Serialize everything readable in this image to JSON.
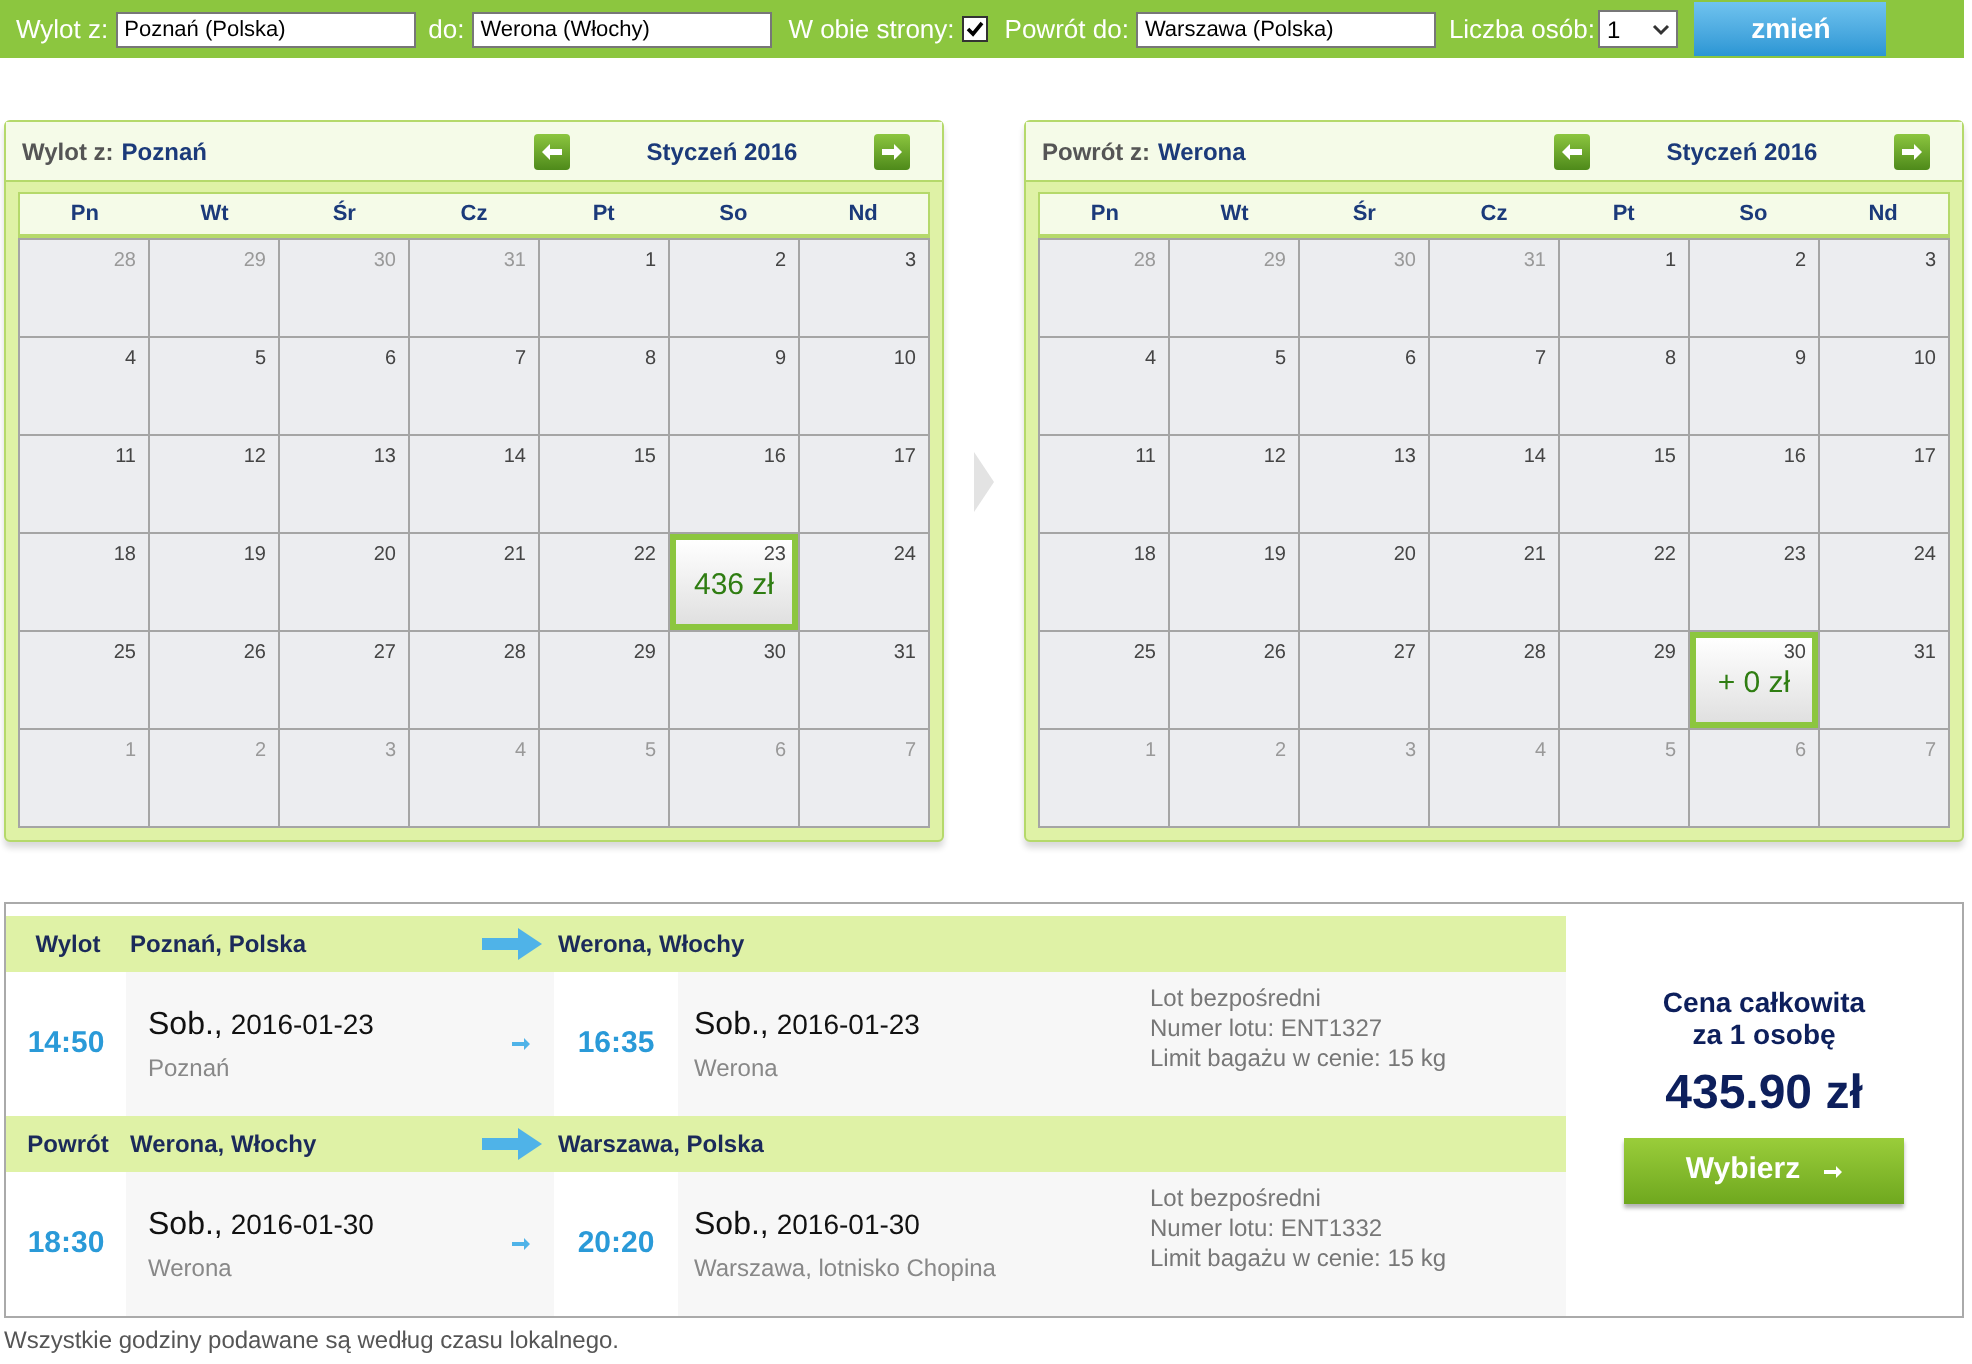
{
  "search_bar": {
    "from_label": "Wylot z:",
    "from_value": "Poznań (Polska)",
    "to_label": "do:",
    "to_value": "Werona (Włochy)",
    "round_trip_label": "W obie strony:",
    "round_trip_checked": true,
    "return_label": "Powrót do:",
    "return_value": "Warszawa (Polska)",
    "persons_label": "Liczba osób:",
    "persons_value": "1",
    "submit": "zmień"
  },
  "calendars": [
    {
      "label": "Wylot z:",
      "city": "Poznań",
      "month": "Styczeń 2016",
      "weekdays": [
        "Pn",
        "Wt",
        "Śr",
        "Cz",
        "Pt",
        "So",
        "Nd"
      ],
      "weeks": [
        [
          {
            "day": "28",
            "muted": true,
            "selected": false
          },
          {
            "day": "29",
            "muted": true,
            "selected": false
          },
          {
            "day": "30",
            "muted": true,
            "selected": false
          },
          {
            "day": "31",
            "muted": true,
            "selected": false
          },
          {
            "day": "1",
            "muted": false,
            "selected": false
          },
          {
            "day": "2",
            "muted": false,
            "selected": false
          },
          {
            "day": "3",
            "muted": false,
            "selected": false
          }
        ],
        [
          {
            "day": "4",
            "muted": false,
            "selected": false
          },
          {
            "day": "5",
            "muted": false,
            "selected": false
          },
          {
            "day": "6",
            "muted": false,
            "selected": false
          },
          {
            "day": "7",
            "muted": false,
            "selected": false
          },
          {
            "day": "8",
            "muted": false,
            "selected": false
          },
          {
            "day": "9",
            "muted": false,
            "selected": false
          },
          {
            "day": "10",
            "muted": false,
            "selected": false
          }
        ],
        [
          {
            "day": "11",
            "muted": false,
            "selected": false
          },
          {
            "day": "12",
            "muted": false,
            "selected": false
          },
          {
            "day": "13",
            "muted": false,
            "selected": false
          },
          {
            "day": "14",
            "muted": false,
            "selected": false
          },
          {
            "day": "15",
            "muted": false,
            "selected": false
          },
          {
            "day": "16",
            "muted": false,
            "selected": false
          },
          {
            "day": "17",
            "muted": false,
            "selected": false
          }
        ],
        [
          {
            "day": "18",
            "muted": false,
            "selected": false
          },
          {
            "day": "19",
            "muted": false,
            "selected": false
          },
          {
            "day": "20",
            "muted": false,
            "selected": false
          },
          {
            "day": "21",
            "muted": false,
            "selected": false
          },
          {
            "day": "22",
            "muted": false,
            "selected": false
          },
          {
            "day": "23",
            "muted": false,
            "selected": true,
            "price": "436 zł"
          },
          {
            "day": "24",
            "muted": false,
            "selected": false
          }
        ],
        [
          {
            "day": "25",
            "muted": false,
            "selected": false
          },
          {
            "day": "26",
            "muted": false,
            "selected": false
          },
          {
            "day": "27",
            "muted": false,
            "selected": false
          },
          {
            "day": "28",
            "muted": false,
            "selected": false
          },
          {
            "day": "29",
            "muted": false,
            "selected": false
          },
          {
            "day": "30",
            "muted": false,
            "selected": false
          },
          {
            "day": "31",
            "muted": false,
            "selected": false
          }
        ],
        [
          {
            "day": "1",
            "muted": true,
            "selected": false
          },
          {
            "day": "2",
            "muted": true,
            "selected": false
          },
          {
            "day": "3",
            "muted": true,
            "selected": false
          },
          {
            "day": "4",
            "muted": true,
            "selected": false
          },
          {
            "day": "5",
            "muted": true,
            "selected": false
          },
          {
            "day": "6",
            "muted": true,
            "selected": false
          },
          {
            "day": "7",
            "muted": true,
            "selected": false
          }
        ]
      ]
    },
    {
      "label": "Powrót z:",
      "city": "Werona",
      "month": "Styczeń 2016",
      "weekdays": [
        "Pn",
        "Wt",
        "Śr",
        "Cz",
        "Pt",
        "So",
        "Nd"
      ],
      "weeks": [
        [
          {
            "day": "28",
            "muted": true,
            "selected": false
          },
          {
            "day": "29",
            "muted": true,
            "selected": false
          },
          {
            "day": "30",
            "muted": true,
            "selected": false
          },
          {
            "day": "31",
            "muted": true,
            "selected": false
          },
          {
            "day": "1",
            "muted": false,
            "selected": false
          },
          {
            "day": "2",
            "muted": false,
            "selected": false
          },
          {
            "day": "3",
            "muted": false,
            "selected": false
          }
        ],
        [
          {
            "day": "4",
            "muted": false,
            "selected": false
          },
          {
            "day": "5",
            "muted": false,
            "selected": false
          },
          {
            "day": "6",
            "muted": false,
            "selected": false
          },
          {
            "day": "7",
            "muted": false,
            "selected": false
          },
          {
            "day": "8",
            "muted": false,
            "selected": false
          },
          {
            "day": "9",
            "muted": false,
            "selected": false
          },
          {
            "day": "10",
            "muted": false,
            "selected": false
          }
        ],
        [
          {
            "day": "11",
            "muted": false,
            "selected": false
          },
          {
            "day": "12",
            "muted": false,
            "selected": false
          },
          {
            "day": "13",
            "muted": false,
            "selected": false
          },
          {
            "day": "14",
            "muted": false,
            "selected": false
          },
          {
            "day": "15",
            "muted": false,
            "selected": false
          },
          {
            "day": "16",
            "muted": false,
            "selected": false
          },
          {
            "day": "17",
            "muted": false,
            "selected": false
          }
        ],
        [
          {
            "day": "18",
            "muted": false,
            "selected": false
          },
          {
            "day": "19",
            "muted": false,
            "selected": false
          },
          {
            "day": "20",
            "muted": false,
            "selected": false
          },
          {
            "day": "21",
            "muted": false,
            "selected": false
          },
          {
            "day": "22",
            "muted": false,
            "selected": false
          },
          {
            "day": "23",
            "muted": false,
            "selected": false
          },
          {
            "day": "24",
            "muted": false,
            "selected": false
          }
        ],
        [
          {
            "day": "25",
            "muted": false,
            "selected": false
          },
          {
            "day": "26",
            "muted": false,
            "selected": false
          },
          {
            "day": "27",
            "muted": false,
            "selected": false
          },
          {
            "day": "28",
            "muted": false,
            "selected": false
          },
          {
            "day": "29",
            "muted": false,
            "selected": false
          },
          {
            "day": "30",
            "muted": false,
            "selected": true,
            "price": "+ 0 zł"
          },
          {
            "day": "31",
            "muted": false,
            "selected": false
          }
        ],
        [
          {
            "day": "1",
            "muted": true,
            "selected": false
          },
          {
            "day": "2",
            "muted": true,
            "selected": false
          },
          {
            "day": "3",
            "muted": true,
            "selected": false
          },
          {
            "day": "4",
            "muted": true,
            "selected": false
          },
          {
            "day": "5",
            "muted": true,
            "selected": false
          },
          {
            "day": "6",
            "muted": true,
            "selected": false
          },
          {
            "day": "7",
            "muted": true,
            "selected": false
          }
        ]
      ]
    }
  ],
  "flights": [
    {
      "label": "Wylot",
      "from": "Poznań, Polska",
      "to": "Werona, Włochy",
      "dep_time": "14:50",
      "dep_day": "Sob.,",
      "dep_date": "2016-01-23",
      "dep_place": "Poznań",
      "arr_time": "16:35",
      "arr_day": "Sob.,",
      "arr_date": "2016-01-23",
      "arr_place": "Werona",
      "info": [
        "Lot bezpośredni",
        "Numer lotu: ENT1327",
        "Limit bagażu w cenie: 15 kg"
      ]
    },
    {
      "label": "Powrót",
      "from": "Werona, Włochy",
      "to": "Warszawa, Polska",
      "dep_time": "18:30",
      "dep_day": "Sob.,",
      "dep_date": "2016-01-30",
      "dep_place": "Werona",
      "arr_time": "20:20",
      "arr_day": "Sob.,",
      "arr_date": "2016-01-30",
      "arr_place": "Warszawa, lotnisko Chopina",
      "info": [
        "Lot bezpośredni",
        "Numer lotu: ENT1332",
        "Limit bagażu w cenie: 15 kg"
      ]
    }
  ],
  "price": {
    "title_line_1": "Cena całkowita",
    "title_line_2": "za 1 osobę",
    "amount": "435.90 zł",
    "button": "Wybierz"
  },
  "footer": "Wszystkie godziny podawane są według czasu lokalnego."
}
